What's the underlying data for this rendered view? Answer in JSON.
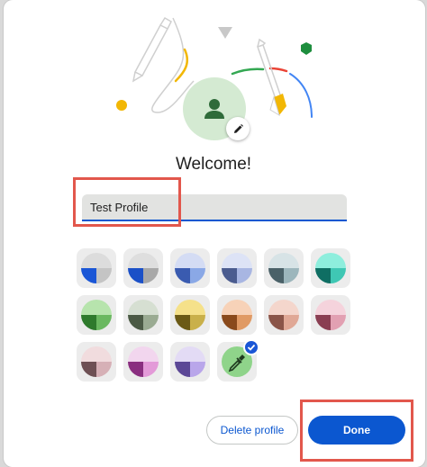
{
  "dialog": {
    "title": "Welcome!",
    "name_field": {
      "value": "Test Profile",
      "placeholder": ""
    }
  },
  "avatar": {
    "icon": "person-icon",
    "edit_icon": "pencil-icon"
  },
  "colors": {
    "accent": "#0b57d0",
    "field_bg": "#e2e3e1",
    "highlight": "#e2574c"
  },
  "theme_swatches": [
    {
      "name": "blue-grey",
      "light": "#dcdcdc",
      "accent": "#1a56d6",
      "tint": "#c4c4c4",
      "selected": false
    },
    {
      "name": "grey-blue",
      "light": "#dedede",
      "accent": "#1b50c7",
      "tint": "#a8a8a8",
      "selected": false
    },
    {
      "name": "blue",
      "light": "#d4dcf4",
      "accent": "#3a5bb0",
      "tint": "#8aa8e6",
      "selected": false
    },
    {
      "name": "lavender-blue",
      "light": "#dde3f6",
      "accent": "#4b5c8f",
      "tint": "#a8b6e2",
      "selected": false
    },
    {
      "name": "slate",
      "light": "#d7e3e6",
      "accent": "#4a6168",
      "tint": "#9cb6bc",
      "selected": false
    },
    {
      "name": "teal",
      "light": "#8eeedd",
      "accent": "#0f6e63",
      "tint": "#3fc7b4",
      "selected": false
    },
    {
      "name": "green",
      "light": "#b7e4ad",
      "accent": "#2e7a2c",
      "tint": "#6ab860",
      "selected": false
    },
    {
      "name": "olive-grey",
      "light": "#d6dfd2",
      "accent": "#4b5a45",
      "tint": "#9aab92",
      "selected": false
    },
    {
      "name": "yellow",
      "light": "#f5e18a",
      "accent": "#6b5a16",
      "tint": "#c9b04a",
      "selected": false
    },
    {
      "name": "orange",
      "light": "#f7d2b8",
      "accent": "#8a4a1c",
      "tint": "#e09a64",
      "selected": false
    },
    {
      "name": "peach",
      "light": "#f4d6cc",
      "accent": "#8a5448",
      "tint": "#e0a896",
      "selected": false
    },
    {
      "name": "rose",
      "light": "#f5d3dc",
      "accent": "#8a3e52",
      "tint": "#e2a0b2",
      "selected": false
    },
    {
      "name": "pink-grey",
      "light": "#f1dcde",
      "accent": "#6e5054",
      "tint": "#d6b0b6",
      "selected": false
    },
    {
      "name": "magenta",
      "light": "#f2d6ee",
      "accent": "#8a2f80",
      "tint": "#e39ad8",
      "selected": false
    },
    {
      "name": "purple",
      "light": "#e3dbf5",
      "accent": "#5c4896",
      "tint": "#b9a6ea",
      "selected": false
    },
    {
      "name": "custom",
      "light": "#8fd48a",
      "accent": "#8fd48a",
      "tint": "#8fd48a",
      "selected": true
    }
  ],
  "buttons": {
    "delete_label": "Delete profile",
    "done_label": "Done"
  }
}
